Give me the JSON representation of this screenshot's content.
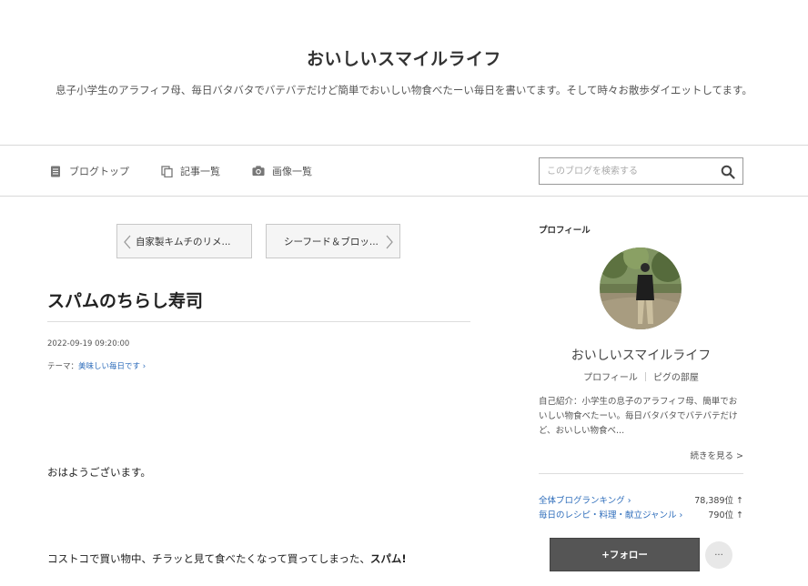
{
  "header": {
    "title": "おいしいスマイルライフ",
    "description": "息子小学生のアラフィフ母、毎日バタバタでバテバテだけど簡単でおいしい物食べたーい毎日を書いてます。そして時々お散歩ダイエットしてます。"
  },
  "nav": {
    "items": [
      {
        "label": "ブログトップ",
        "icon": "document-icon"
      },
      {
        "label": "記事一覧",
        "icon": "copy-icon"
      },
      {
        "label": "画像一覧",
        "icon": "camera-icon"
      }
    ],
    "search_placeholder": "このブログを検索する"
  },
  "pager": {
    "prev_label": "自家製キムチのリメ...",
    "next_label": "シーフード＆ブロッ..."
  },
  "article": {
    "title": "スパムのちらし寿司",
    "date": "2022-09-19 09:20:00",
    "theme_prefix": "テーマ：",
    "theme_link": "美味しい毎日です",
    "paragraph1": "おはようございます。",
    "paragraph2_text": "コストコで買い物中、チラッと見て食べたくなって買ってしまった、",
    "paragraph2_bold": "スパム!"
  },
  "sidebar": {
    "heading": "プロフィール",
    "name": "おいしいスマイルライフ",
    "profile_link": "プロフィール",
    "room_link": "ピグの部屋",
    "intro": "自己紹介：小学生の息子のアラフィフ母、簡単でおいしい物食べたーい。毎日バタバタでバテバテだけど、おいしい物食べ...",
    "readmore": "続きを見る >",
    "rankings": [
      {
        "label": "全体ブログランキング",
        "value": "78,389位 ↑"
      },
      {
        "label": "毎日のレシピ・料理・献立ジャンル",
        "value": "790位 ↑"
      }
    ],
    "follow_label": "+フォロー",
    "more_label": "···"
  },
  "colors": {
    "link": "#2e6dbb",
    "follow_button": "#555555",
    "divider": "#d8d8d8"
  }
}
